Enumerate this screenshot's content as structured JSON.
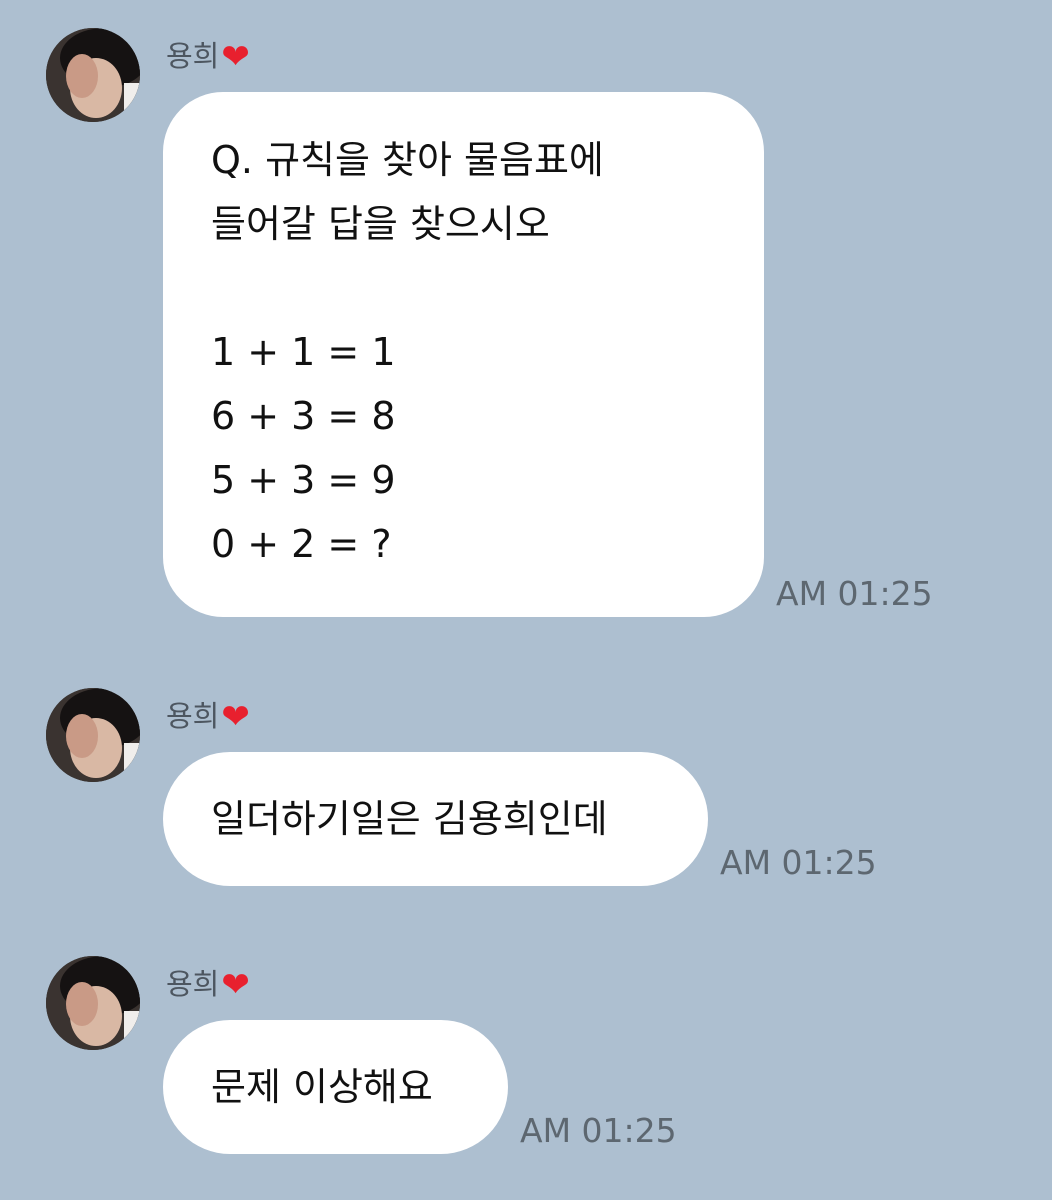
{
  "messages": [
    {
      "sender": "용희",
      "lines": [
        "Q. 규칙을 찾아 물음표에",
        "들어갈 답을 찾으시오",
        "",
        "1 + 1 = 1",
        "6 + 3 = 8",
        "5 + 3 = 9",
        "0 + 2 = ?"
      ],
      "time": "AM 01:25"
    },
    {
      "sender": "용희",
      "lines": [
        "일더하기일은 김용희인데"
      ],
      "time": "AM 01:25"
    },
    {
      "sender": "용희",
      "lines": [
        "문제 이상해요"
      ],
      "time": "AM 01:25"
    }
  ],
  "icons": {
    "heart": "❤",
    "heart_color": "#e8202e"
  },
  "colors": {
    "background": "#adbfd0",
    "bubble": "#ffffff",
    "time_text": "#5d6770"
  }
}
